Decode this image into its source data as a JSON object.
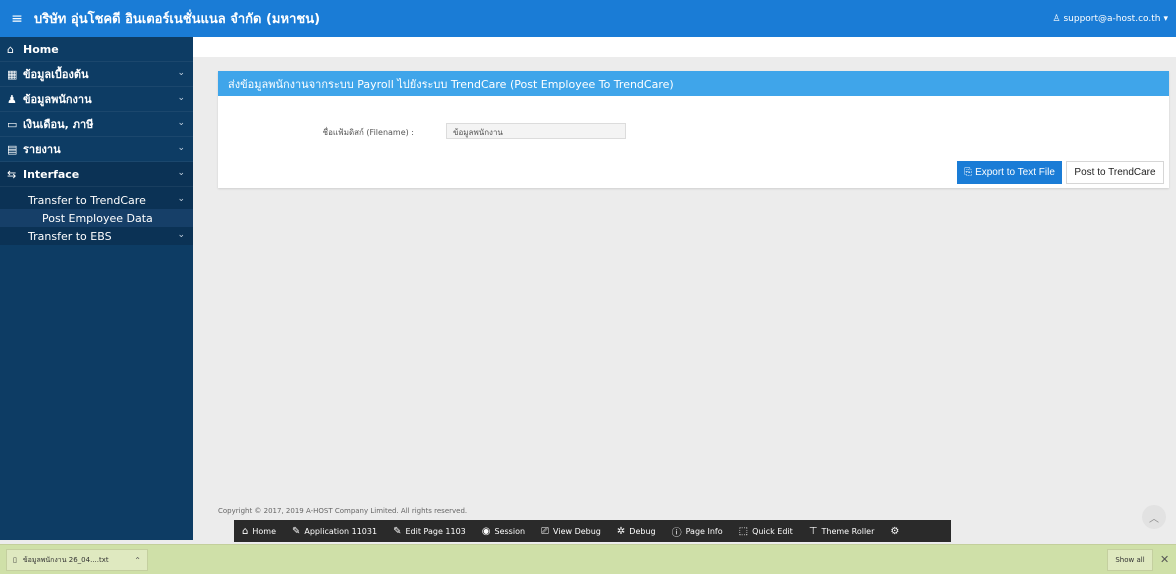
{
  "header": {
    "menu_icon": "hamburger-icon",
    "title": "บริษัท อุ่นโชคดี อินเตอร์เนชั่นแนล จำกัด (มหาชน)",
    "user": "support@a-host.co.th",
    "accent": "#1a7cd6"
  },
  "sidebar": {
    "items": [
      {
        "label": "Home",
        "icon": "home-icon"
      },
      {
        "label": "ข้อมูลเบื้องต้น",
        "icon": "grid-icon"
      },
      {
        "label": "ข้อมูลพนักงาน",
        "icon": "people-icon"
      },
      {
        "label": "เงินเดือน, ภาษี",
        "icon": "money-icon"
      },
      {
        "label": "รายงาน",
        "icon": "report-icon"
      },
      {
        "label": "Interface",
        "icon": "exchange-icon"
      }
    ],
    "sub_items": [
      {
        "label": "Transfer to TrendCare"
      },
      {
        "label": "Post Employee Data"
      },
      {
        "label": "Transfer to EBS"
      }
    ],
    "bg_color": "#0d3c64"
  },
  "region": {
    "title": "ส่งข้อมูลพนักงานจากระบบ Payroll ไปยังระบบ TrendCare (Post Employee To TrendCare)",
    "filename_label": "ชื่อแฟ้มดิสก์ (Filename) :",
    "filename_value": "ข้อมูลพนักงาน",
    "export_label": "Export to Text File",
    "post_label": "Post to TrendCare",
    "header_color": "#3fa5ea"
  },
  "footer": {
    "copyright": "Copyright © 2017, 2019 A-HOST Company Limited. All rights reserved."
  },
  "devbar": {
    "items": [
      {
        "label": "Home",
        "icon": "home-icon"
      },
      {
        "label": "Application 11031",
        "icon": "edit-icon"
      },
      {
        "label": "Edit Page 1103",
        "icon": "edit-icon"
      },
      {
        "label": "Session",
        "icon": "eye-icon"
      },
      {
        "label": "View Debug",
        "icon": "debug-view-icon"
      },
      {
        "label": "Debug",
        "icon": "bug-icon"
      },
      {
        "label": "Page Info",
        "icon": "info-icon"
      },
      {
        "label": "Quick Edit",
        "icon": "cursor-icon"
      },
      {
        "label": "Theme Roller",
        "icon": "paint-roller-icon"
      }
    ]
  },
  "download_bar": {
    "file_name": "ข้อมูลพนักงาน 26_04....txt",
    "show_all": "Show all"
  }
}
